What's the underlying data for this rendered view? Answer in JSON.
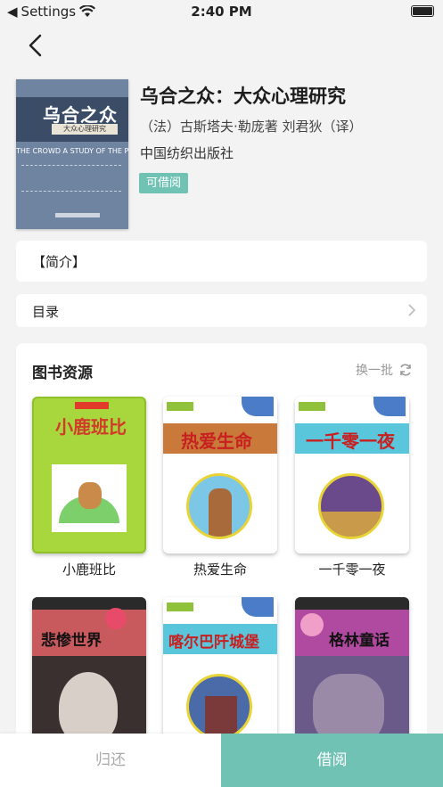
{
  "status_bar": {
    "carrier": "Settings",
    "time": "2:40 PM"
  },
  "book": {
    "cover_title": "乌合之众",
    "cover_subtitle": "大众心理研究",
    "cover_english": "THE CROWD  A STUDY OF THE POPULAR MIND",
    "title": "乌合之众：大众心理研究",
    "author": "（法）古斯塔夫·勒庞著 刘君狄（译）",
    "publisher": "中国纺织出版社",
    "status": "可借阅"
  },
  "sections": {
    "intro": "【简介】",
    "toc": "目录"
  },
  "resources": {
    "title": "图书资源",
    "refresh_label": "换一批",
    "items": [
      {
        "title": "小鹿班比",
        "cover_text": "小鹿班比",
        "bg": "#a8d63d"
      },
      {
        "title": "热爱生命",
        "cover_text": "热爱生命",
        "bg": "#ffffff"
      },
      {
        "title": "一千零一夜",
        "cover_text": "一千零一夜",
        "bg": "#ffffff"
      },
      {
        "title": "",
        "cover_text": "悲惨世界",
        "bg": "#c8595d"
      },
      {
        "title": "",
        "cover_text": "喀尔巴阡城堡",
        "bg": "#ffffff"
      },
      {
        "title": "",
        "cover_text": "格林童话",
        "bg": "#b04aa0"
      }
    ]
  },
  "actions": {
    "return": "归还",
    "borrow": "借阅"
  },
  "colors": {
    "accent": "#70c2b4"
  }
}
